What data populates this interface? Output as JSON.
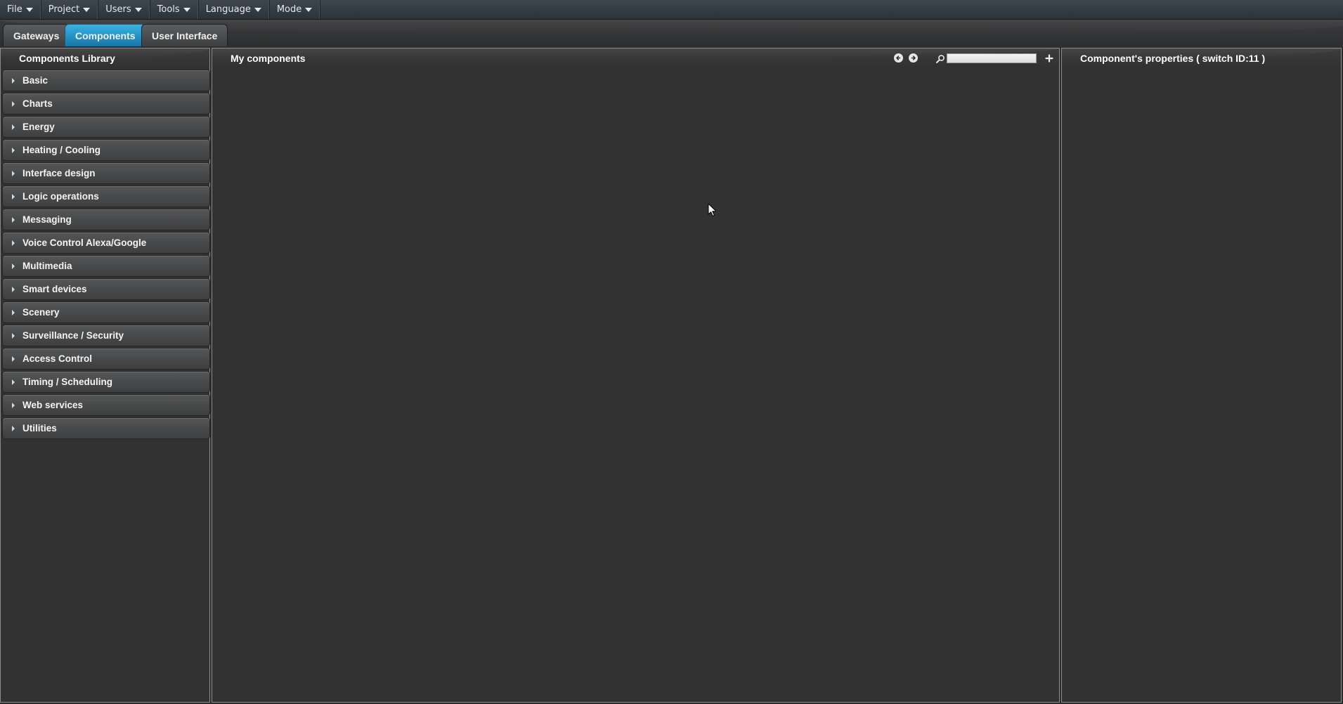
{
  "menubar": {
    "items": [
      {
        "label": "File"
      },
      {
        "label": "Project"
      },
      {
        "label": "Users"
      },
      {
        "label": "Tools"
      },
      {
        "label": "Language"
      },
      {
        "label": "Mode"
      }
    ]
  },
  "tabs": [
    {
      "label": "Gateways",
      "active": false
    },
    {
      "label": "Components",
      "active": true
    },
    {
      "label": "User Interface",
      "active": false
    }
  ],
  "library": {
    "title": "Components Library",
    "categories": [
      {
        "label": "Basic"
      },
      {
        "label": "Charts"
      },
      {
        "label": "Energy"
      },
      {
        "label": "Heating / Cooling"
      },
      {
        "label": "Interface design"
      },
      {
        "label": "Logic operations"
      },
      {
        "label": "Messaging"
      },
      {
        "label": "Voice Control Alexa/Google"
      },
      {
        "label": "Multimedia"
      },
      {
        "label": "Smart devices"
      },
      {
        "label": "Scenery"
      },
      {
        "label": "Surveillance / Security"
      },
      {
        "label": "Access Control"
      },
      {
        "label": "Timing / Scheduling"
      },
      {
        "label": "Web services"
      },
      {
        "label": "Utilities"
      }
    ]
  },
  "my_components": {
    "title": "My components",
    "search": {
      "value": "",
      "placeholder": ""
    },
    "icons": {
      "back": "arrow-left-circle-icon",
      "forward": "arrow-right-circle-icon",
      "search": "magnifier-icon",
      "add": "plus-icon"
    }
  },
  "properties": {
    "title": "Component's properties ( switch ID:11 )"
  },
  "colors": {
    "accent": "#1f8fc6",
    "panel_bg": "#323232",
    "menubar_bg": "#333a42",
    "panel_border": "#8b8b8b"
  }
}
